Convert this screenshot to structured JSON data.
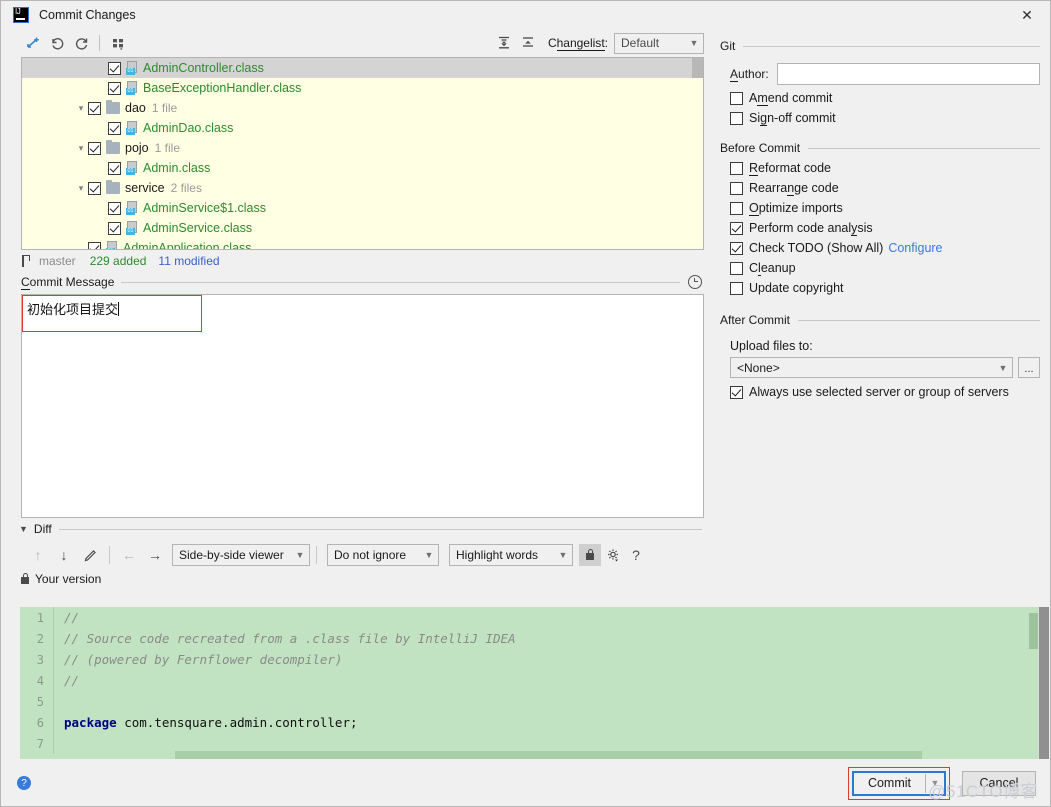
{
  "window": {
    "title": "Commit Changes",
    "logo_text": "IJ",
    "close_label": "✕"
  },
  "changes_toolbar": {
    "icons": [
      "revert-smart-icon",
      "rollback-icon",
      "refresh-icon",
      "group-by-icon"
    ],
    "expand_all_icon": "expand-all-icon",
    "collapse_all_icon": "collapse-all-icon",
    "changelist_label_a": "C",
    "changelist_label_b": "hangelis",
    "changelist_label_c": "t",
    "changelist_label_d": ":",
    "changelist_value": "Default"
  },
  "tree": {
    "rows": [
      {
        "indent": 2,
        "expander": "",
        "checked": true,
        "icon": "class-file-icon",
        "label": "AdminController.class",
        "kind": "file",
        "count": "",
        "selected": true
      },
      {
        "indent": 2,
        "expander": "",
        "checked": true,
        "icon": "class-file-icon",
        "label": "BaseExceptionHandler.class",
        "kind": "file",
        "count": "",
        "selected": false
      },
      {
        "indent": 1,
        "expander": "▾",
        "checked": true,
        "icon": "folder-icon",
        "label": "dao",
        "kind": "dir",
        "count": "1 file",
        "selected": false
      },
      {
        "indent": 2,
        "expander": "",
        "checked": true,
        "icon": "class-file-icon",
        "label": "AdminDao.class",
        "kind": "file",
        "count": "",
        "selected": false
      },
      {
        "indent": 1,
        "expander": "▾",
        "checked": true,
        "icon": "folder-icon",
        "label": "pojo",
        "kind": "dir",
        "count": "1 file",
        "selected": false
      },
      {
        "indent": 2,
        "expander": "",
        "checked": true,
        "icon": "class-file-icon",
        "label": "Admin.class",
        "kind": "file",
        "count": "",
        "selected": false
      },
      {
        "indent": 1,
        "expander": "▾",
        "checked": true,
        "icon": "folder-icon",
        "label": "service",
        "kind": "dir",
        "count": "2 files",
        "selected": false
      },
      {
        "indent": 2,
        "expander": "",
        "checked": true,
        "icon": "class-file-icon",
        "label": "AdminService$1.class",
        "kind": "file",
        "count": "",
        "selected": false
      },
      {
        "indent": 2,
        "expander": "",
        "checked": true,
        "icon": "class-file-icon",
        "label": "AdminService.class",
        "kind": "file",
        "count": "",
        "selected": false
      },
      {
        "indent": 1,
        "expander": "",
        "checked": true,
        "icon": "class-file-icon",
        "label": "AdminApplication.class",
        "kind": "file",
        "count": "",
        "selected": false
      }
    ]
  },
  "branch_bar": {
    "branch_icon": "branch-icon",
    "branch": "master",
    "added": "229 added",
    "modified": "11 modified"
  },
  "commit_message": {
    "label_first": "C",
    "label_rest": "ommit Message",
    "clock_icon": "history-clock-icon",
    "value": "初始化项目提交"
  },
  "diff": {
    "section_label": "Diff",
    "toggle_icon": "triangle-down-icon",
    "toolbar": {
      "prev_diff_icon": "arrow-up-icon",
      "next_diff_icon": "arrow-down-icon",
      "edit_icon": "pencil-icon",
      "prev_change_icon": "arrow-left-icon",
      "next_change_icon": "arrow-right-icon",
      "viewer_mode": "Side-by-side viewer",
      "ignore_mode": "Do not ignore",
      "highlight_mode": "Highlight words",
      "lock_icon": "lock-icon",
      "settings_icon": "gear-icon",
      "help_icon": "question-mark-icon"
    },
    "pane_title": "Your version",
    "pane_lock_icon": "lock-icon",
    "code": [
      {
        "num": "1",
        "tokens": [
          {
            "t": "cmt",
            "s": "//"
          }
        ]
      },
      {
        "num": "2",
        "tokens": [
          {
            "t": "cmt",
            "s": "// Source code recreated from a .class file by IntelliJ IDEA"
          }
        ]
      },
      {
        "num": "3",
        "tokens": [
          {
            "t": "cmt",
            "s": "// (powered by Fernflower decompiler)"
          }
        ]
      },
      {
        "num": "4",
        "tokens": [
          {
            "t": "cmt",
            "s": "//"
          }
        ]
      },
      {
        "num": "5",
        "tokens": [
          {
            "t": "plain",
            "s": ""
          }
        ]
      },
      {
        "num": "6",
        "tokens": [
          {
            "t": "kw",
            "s": "package"
          },
          {
            "t": "plain",
            "s": " com.tensquare.admin.controller;"
          }
        ]
      },
      {
        "num": "7",
        "tokens": [
          {
            "t": "plain",
            "s": ""
          }
        ]
      }
    ]
  },
  "git_section": {
    "title": "Git",
    "author_label_first": "A",
    "author_label_rest": "uthor:",
    "author_value": "",
    "checkboxes": [
      {
        "label_pre": "A",
        "label_hot": "m",
        "label_post": "end commit",
        "checked": false,
        "name": "amend-commit"
      },
      {
        "label_pre": "Si",
        "label_hot": "g",
        "label_post": "n-off commit",
        "checked": false,
        "name": "sign-off-commit"
      }
    ]
  },
  "before_commit": {
    "title": "Before Commit",
    "checkboxes": [
      {
        "label_pre": "",
        "label_hot": "R",
        "label_post": "eformat code",
        "checked": false,
        "name": "reformat-code"
      },
      {
        "label_pre": "Rearra",
        "label_hot": "n",
        "label_post": "ge code",
        "checked": false,
        "name": "rearrange-code"
      },
      {
        "label_pre": "",
        "label_hot": "O",
        "label_post": "ptimize imports",
        "checked": false,
        "name": "optimize-imports"
      },
      {
        "label_pre": "Perform code anal",
        "label_hot": "y",
        "label_post": "sis",
        "checked": true,
        "name": "perform-code-analysis"
      },
      {
        "label_pre": "Check TODO (Show All)",
        "label_hot": "",
        "label_post": "",
        "checked": true,
        "name": "check-todo",
        "link": "Configure"
      },
      {
        "label_pre": "C",
        "label_hot": "l",
        "label_post": "eanup",
        "checked": false,
        "name": "cleanup"
      },
      {
        "label_pre": "Update copyright",
        "label_hot": "",
        "label_post": "",
        "checked": false,
        "name": "update-copyright"
      }
    ]
  },
  "after_commit": {
    "title": "After Commit",
    "upload_label": "Upload files to:",
    "upload_value": "<None>",
    "browse_label": "...",
    "always_use": {
      "label": "Always use selected server or group of servers",
      "checked": true
    }
  },
  "footer": {
    "help_label": "?",
    "commit_label": "Commit",
    "commit_dropdown_icon": "chevron-down-icon",
    "cancel_label": "Cancel",
    "watermark": "@51CTO博客"
  }
}
